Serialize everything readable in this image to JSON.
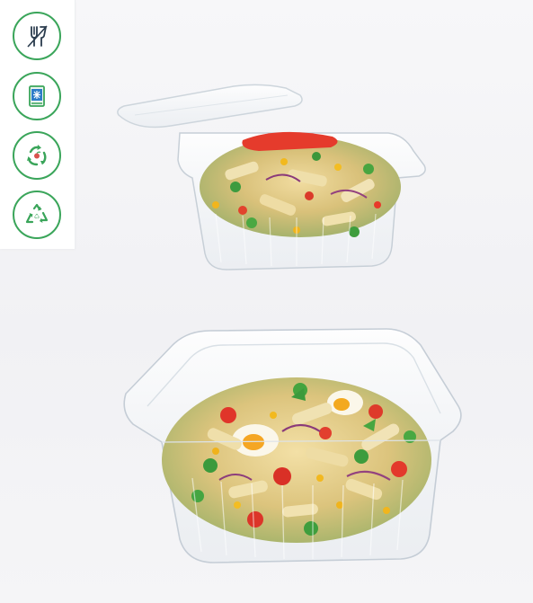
{
  "badges": [
    {
      "icon": "food-safe-icon"
    },
    {
      "icon": "freezer-safe-icon"
    },
    {
      "icon": "recyclable-cycle-icon"
    },
    {
      "icon": "recycle-triangle-icon"
    }
  ],
  "colors": {
    "badge_green": "#3aa55a",
    "badge_blue": "#2d7cc8",
    "badge_stroke": "#2a3b4d",
    "background": "#f4f4f7",
    "panel": "#ffffff"
  },
  "products": [
    {
      "name": "hinged-salad-container-open-lid"
    },
    {
      "name": "hinged-salad-container-closed"
    }
  ]
}
